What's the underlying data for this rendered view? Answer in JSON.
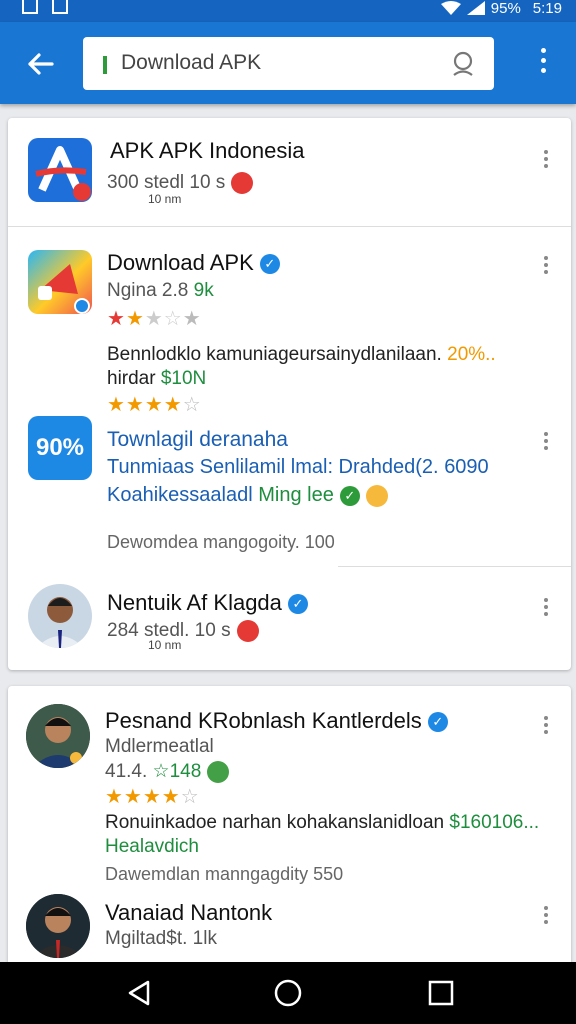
{
  "status_bar": {
    "battery": "95%",
    "time": "5:19"
  },
  "search": {
    "query": "Download APK"
  },
  "results": [
    {
      "title": "APK APK Indonesia",
      "sub": "300 stedl 10 s",
      "tiny": "10 nm"
    },
    {
      "title": "Download APK",
      "sub_prefix": "Ngina 2.8",
      "sub_accent": "9k",
      "rating": 2,
      "desc": "Bennlodklo kamuniageursainydlanilaan.",
      "desc_accent": "20%..",
      "price_prefix": "hirdar",
      "price": "$10N",
      "rating2": 3.5
    },
    {
      "title": "Townlagil deranaha",
      "line2": "Tunmiaas Senlilamil lmal: Drahded(2.",
      "line2_accent": "6090",
      "line3": "Koahikessaaladl",
      "line3_accent": "Ming lee",
      "meta": "Dewomdea mangogoity. 100",
      "icon_text": "90%"
    },
    {
      "title": "Nentuik Af Klagda",
      "sub": "284 stedl. 10 s",
      "tiny": "10 nm"
    },
    {
      "title": "Pesnand KRobnlash Kantlerdels",
      "sub": "Mdlermeatlal",
      "sub2": "41.4.",
      "sub2_accent": "☆148",
      "rating": 3.5,
      "desc": "Ronuinkadoe narhan kohakanslanidloan",
      "desc_accent": "$160106...",
      "desc2": "Healavdich",
      "meta": "Dawemdlan manngagdity 550"
    },
    {
      "title": "Vanaiad Nantonk",
      "sub": "Mgiltad$t. 1lk"
    }
  ],
  "colors": {
    "app_bar": "#1976d2",
    "accent_green": "#1e8e3e",
    "star": "#f29900"
  }
}
